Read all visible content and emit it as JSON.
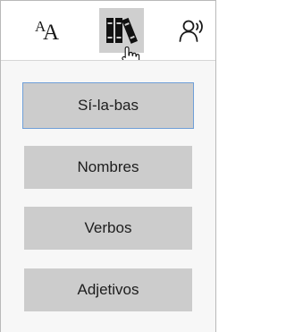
{
  "toolbar": {
    "text_preferences": {
      "icon": "text-size-icon",
      "glyph_small": "A",
      "glyph_big": "A"
    },
    "grammar_options": {
      "icon": "books-icon",
      "active": true
    },
    "read_aloud": {
      "icon": "read-aloud-icon"
    }
  },
  "grammar_panel": {
    "options": [
      {
        "label": "Sí-la-bas",
        "selected": true
      },
      {
        "label": "Nombres",
        "selected": false
      },
      {
        "label": "Verbos",
        "selected": false
      },
      {
        "label": "Adjetivos",
        "selected": false
      }
    ]
  },
  "colors": {
    "active_tab_bg": "#cfcfcf",
    "panel_bg": "#f7f7f7",
    "option_bg": "#cccccc",
    "focus_border": "#6f9fd8"
  }
}
